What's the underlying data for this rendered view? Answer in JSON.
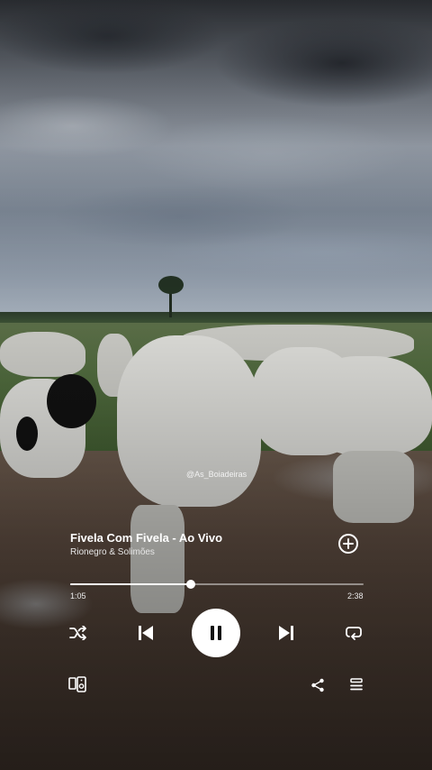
{
  "overlay": {
    "watermark": "@As_Boiadeiras"
  },
  "track": {
    "title": "Fivela Com Fivela - Ao Vivo",
    "artist": "Rionegro & Solimões",
    "elapsed": "1:05",
    "duration": "2:38",
    "progress_fraction": 0.41
  },
  "controls": {
    "add": "plus-circle-icon",
    "shuffle": "shuffle-icon",
    "previous": "skip-previous-icon",
    "play_pause": "pause-icon",
    "next": "skip-next-icon",
    "repeat": "repeat-icon",
    "devices": "devices-icon",
    "share": "share-icon",
    "queue": "queue-icon"
  },
  "colors": {
    "controls": "#ffffff",
    "track": "#ffffff"
  }
}
